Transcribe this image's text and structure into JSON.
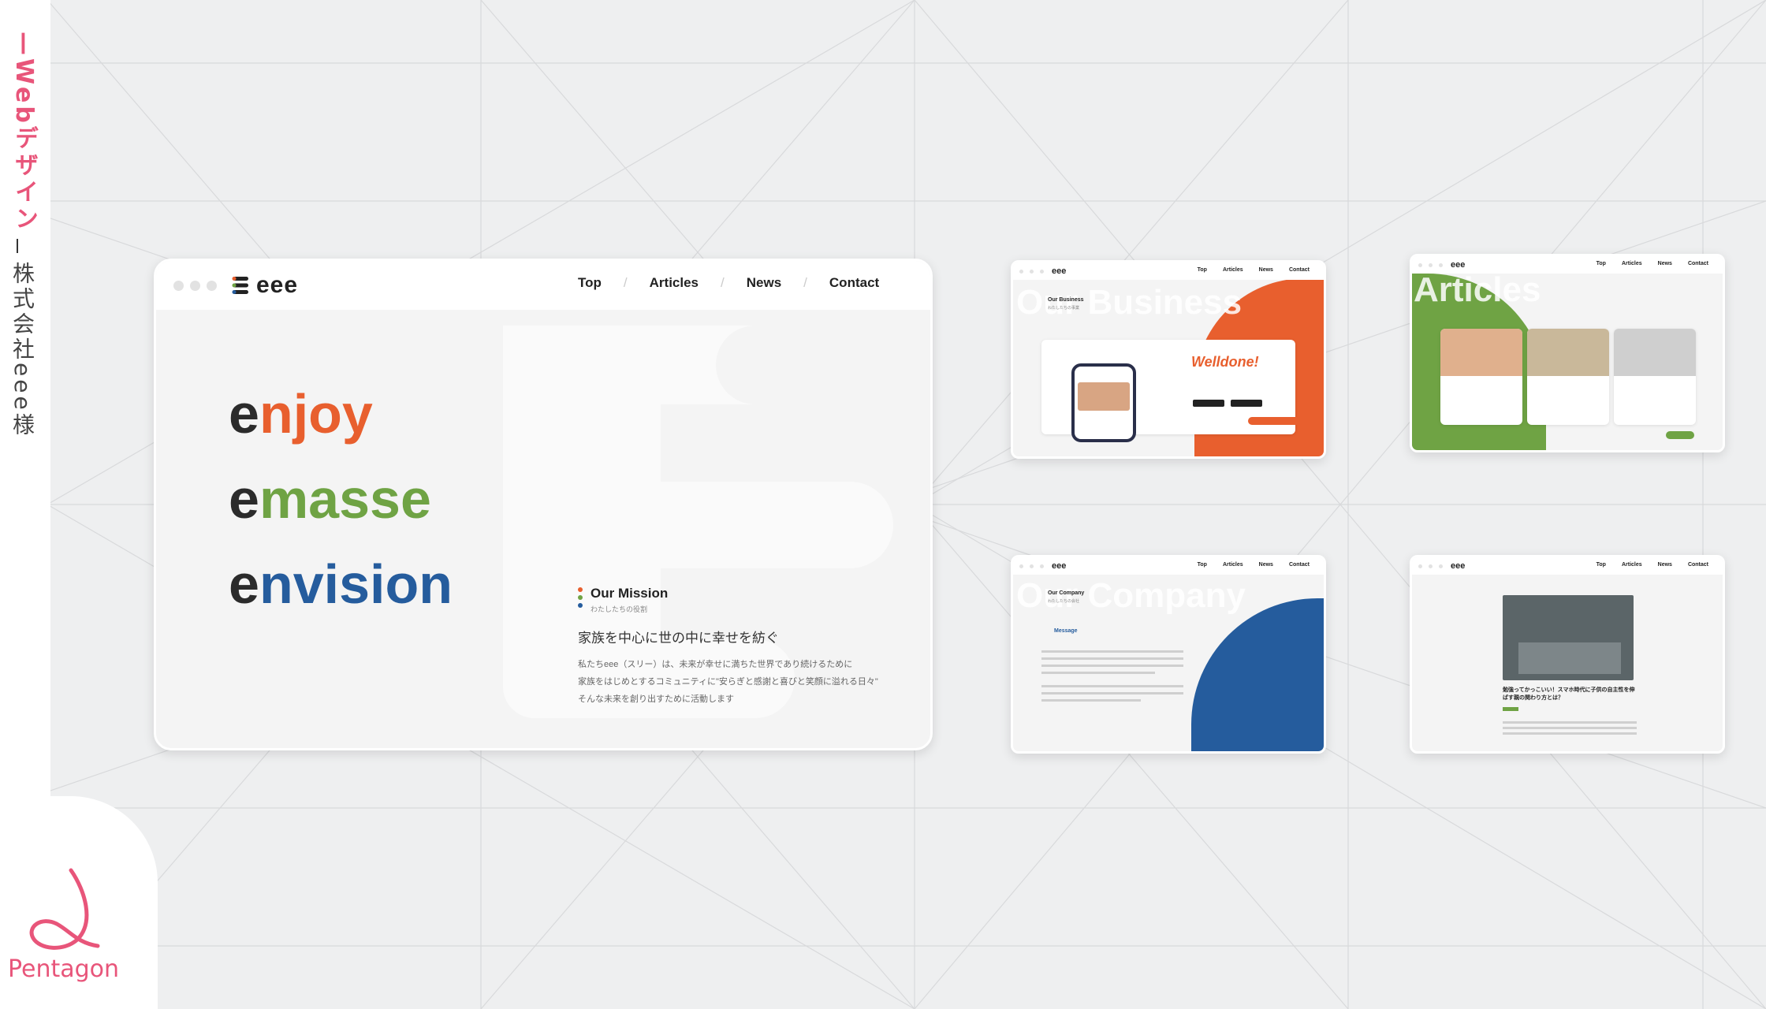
{
  "sidebar": {
    "service_label": "—Webデザイン",
    "client_label": "株式会社eee様",
    "brand_name": "Pentagon"
  },
  "main_mock": {
    "logo": "eee",
    "nav": [
      "Top",
      "Articles",
      "News",
      "Contact"
    ],
    "words": [
      {
        "e": "e",
        "rest": "njoy"
      },
      {
        "e": "e",
        "rest": "masse"
      },
      {
        "e": "e",
        "rest": "nvision"
      }
    ],
    "mission_title": "Our Mission",
    "mission_sub": "わたしたちの役割",
    "mission_heading": "家族を中心に世の中に幸せを紡ぐ",
    "mission_body": [
      "私たちeee（スリー）は、未来が幸せに満ちた世界であり続けるために",
      "家族をはじめとするコミュニティに\"安らぎと感謝と喜びと笑顔に溢れる日々\"",
      "そんな未来を創り出すために活動します"
    ]
  },
  "business_mock": {
    "logo": "eee",
    "nav": [
      "Top",
      "Articles",
      "News",
      "Contact"
    ],
    "ghost_title": "Our Business",
    "section_label": "Our Business",
    "section_sub": "わたしたちの事業",
    "product_name": "Welldone!"
  },
  "articles_mock": {
    "logo": "eee",
    "nav": [
      "Top",
      "Articles",
      "News",
      "Contact"
    ],
    "ghost_title": "Articles",
    "section_label": "Articles"
  },
  "company_mock": {
    "logo": "eee",
    "nav": [
      "Top",
      "Articles",
      "News",
      "Contact"
    ],
    "ghost_title": "Our Company",
    "section_label": "Our Company",
    "section_sub": "わたしたちの会社",
    "message_label": "Message"
  },
  "article_mock": {
    "logo": "eee",
    "nav": [
      "Top",
      "Articles",
      "News",
      "Contact"
    ],
    "headline": "勉強ってかっこいい！スマホ時代に子供の自主性を伸ばす親の関わり方とは？"
  },
  "colors": {
    "accent_pink": "#e8557a",
    "orange": "#e85f2e",
    "green": "#6fa344",
    "blue": "#255c9d"
  }
}
